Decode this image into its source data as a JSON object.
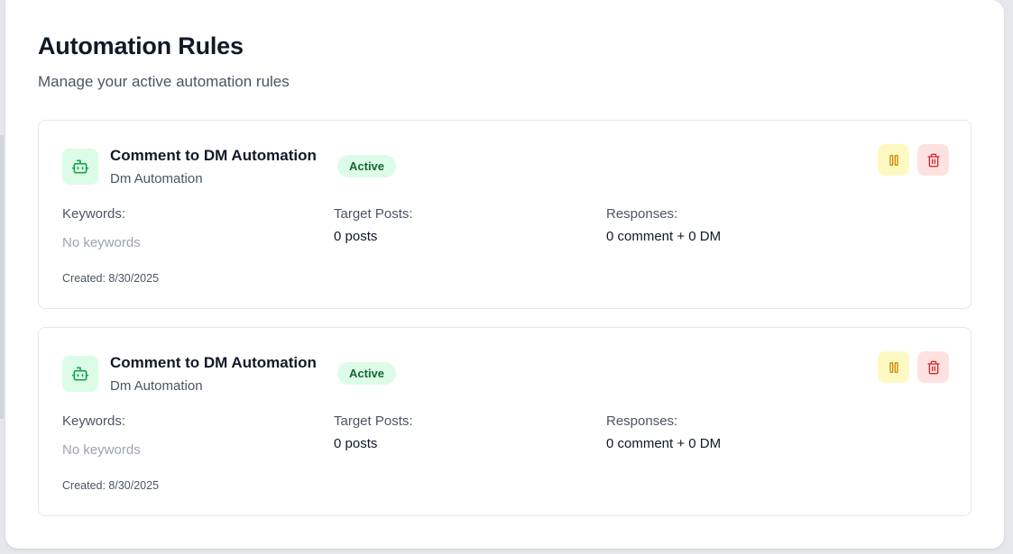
{
  "header": {
    "title": "Automation Rules",
    "subtitle": "Manage your active automation rules"
  },
  "colors": {
    "status_active_bg": "#dcfce7",
    "status_active_text": "#166534",
    "pause_bg": "#fef9c3",
    "pause_icon": "#ca8a04",
    "delete_bg": "#fee2e2",
    "delete_icon": "#dc2626"
  },
  "rules": [
    {
      "icon": "bot-icon",
      "name": "Comment to DM Automation",
      "status": "Active",
      "type": "Dm Automation",
      "keywords_label": "Keywords:",
      "keywords_value": "No keywords",
      "target_posts_label": "Target Posts:",
      "target_posts_value": "0 posts",
      "responses_label": "Responses:",
      "responses_value": "0 comment + 0 DM",
      "created": "Created: 8/30/2025",
      "actions": [
        "pause-icon",
        "trash-icon"
      ]
    },
    {
      "icon": "bot-icon",
      "name": "Comment to DM Automation",
      "status": "Active",
      "type": "Dm Automation",
      "keywords_label": "Keywords:",
      "keywords_value": "No keywords",
      "target_posts_label": "Target Posts:",
      "target_posts_value": "0 posts",
      "responses_label": "Responses:",
      "responses_value": "0 comment + 0 DM",
      "created": "Created: 8/30/2025",
      "actions": [
        "pause-icon",
        "trash-icon"
      ]
    }
  ]
}
